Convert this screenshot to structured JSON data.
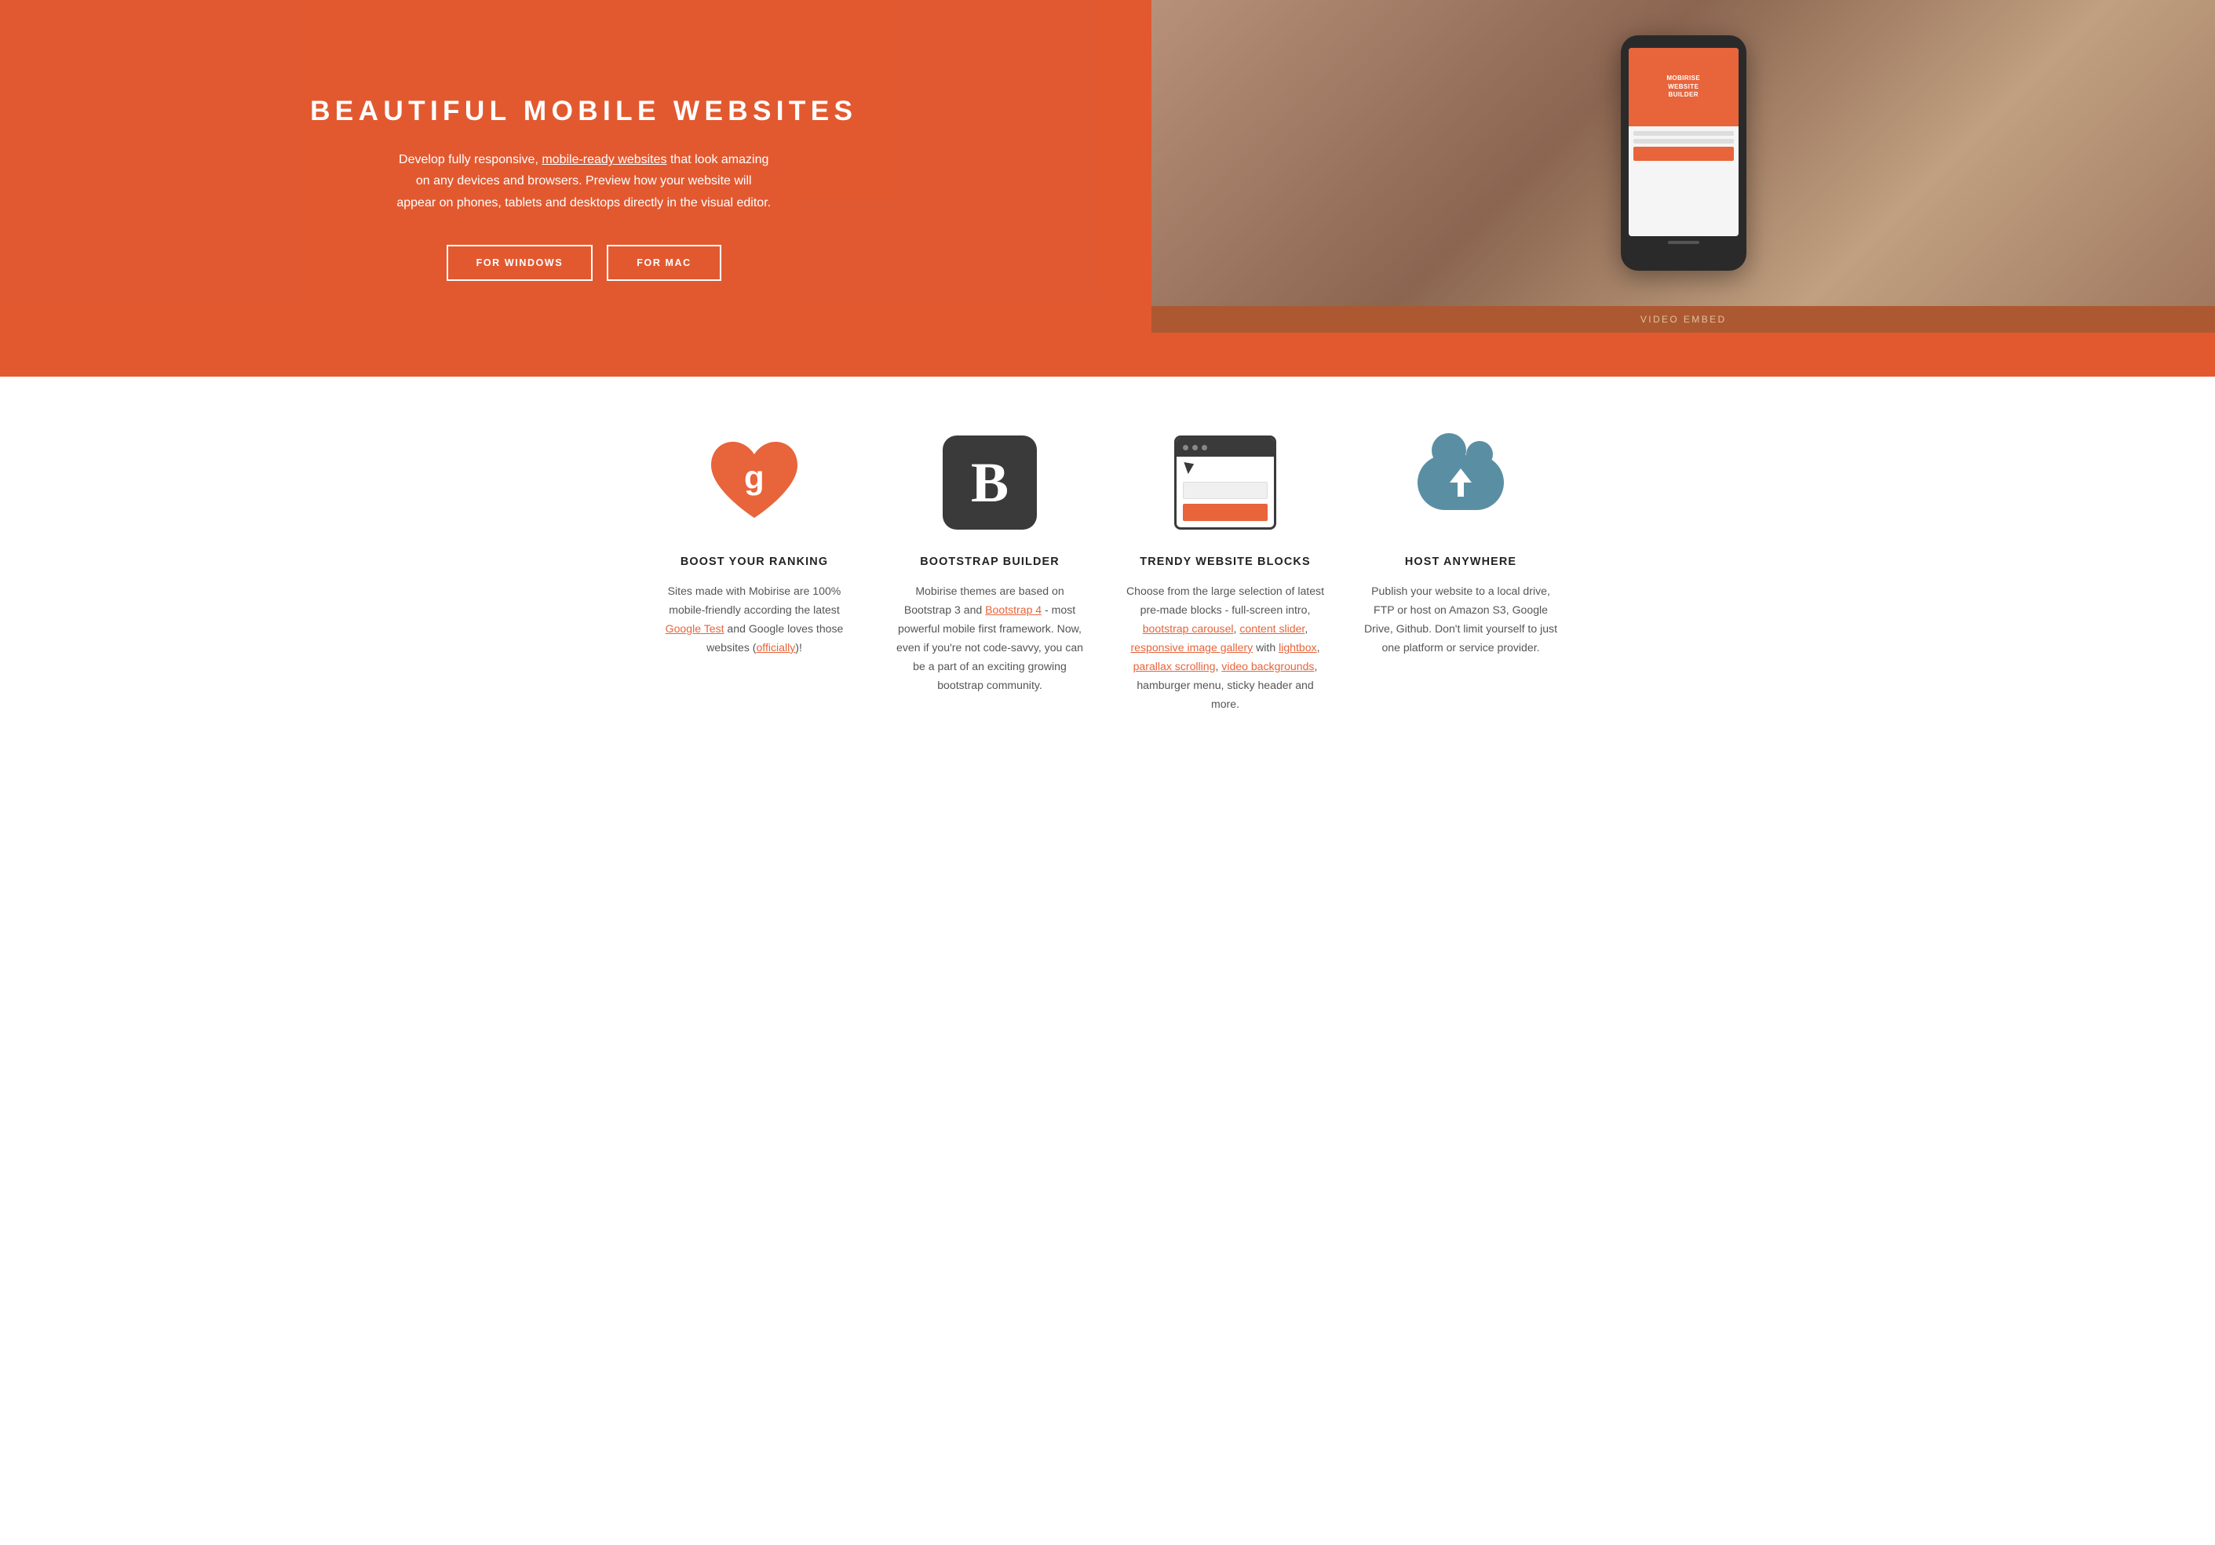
{
  "hero": {
    "title": "BEAUTIFUL MOBILE WEBSITES",
    "description_part1": "Develop fully responsive, ",
    "description_link": "mobile-ready websites",
    "description_part2": " that look amazing on any devices and browsers. Preview how your website will appear on phones, tablets and desktops directly in the visual editor.",
    "button_windows": "FOR WINDOWS",
    "button_mac": "FOR MAC",
    "phone_screen_text": "MOBIRISE\nWEBSITE\nBUILDER",
    "video_embed_label": "VIDEO EMBED"
  },
  "features": [
    {
      "id": "boost",
      "icon": "google-heart-icon",
      "title": "BOOST YOUR RANKING",
      "desc_plain": "Sites made with Mobirise are 100% mobile-friendly according the latest ",
      "desc_link1_text": "Google Test",
      "desc_link1_url": "#",
      "desc_mid": " and Google loves those websites (",
      "desc_link2_text": "officially",
      "desc_link2_url": "#",
      "desc_end": ")!"
    },
    {
      "id": "bootstrap",
      "icon": "bootstrap-icon",
      "title": "BOOTSTRAP BUILDER",
      "desc_plain": "Mobirise themes are based on Bootstrap 3 and ",
      "desc_link1_text": "Bootstrap 4",
      "desc_link1_url": "#",
      "desc_end": " - most powerful mobile first framework. Now, even if you're not code-savvy, you can be a part of an exciting growing bootstrap community."
    },
    {
      "id": "trendy",
      "icon": "browser-blocks-icon",
      "title": "TRENDY WEBSITE BLOCKS",
      "desc_plain": "Choose from the large selection of latest pre-made blocks - full-screen intro, ",
      "desc_link1_text": "bootstrap carousel",
      "desc_link1_url": "#",
      "desc_sep1": ", ",
      "desc_link2_text": "content slider",
      "desc_link2_url": "#",
      "desc_sep2": ", ",
      "desc_link3_text": "responsive image gallery",
      "desc_link3_url": "#",
      "desc_mid": " with ",
      "desc_link4_text": "lightbox",
      "desc_link4_url": "#",
      "desc_sep3": ", ",
      "desc_link5_text": "parallax scrolling",
      "desc_link5_url": "#",
      "desc_sep4": ", ",
      "desc_link6_text": "video backgrounds",
      "desc_link6_url": "#",
      "desc_end": ", hamburger menu, sticky header and more."
    },
    {
      "id": "host",
      "icon": "cloud-upload-icon",
      "title": "HOST ANYWHERE",
      "desc": "Publish your website to a local drive, FTP or host on Amazon S3, Google Drive, Github. Don't limit yourself to just one platform or service provider."
    }
  ]
}
